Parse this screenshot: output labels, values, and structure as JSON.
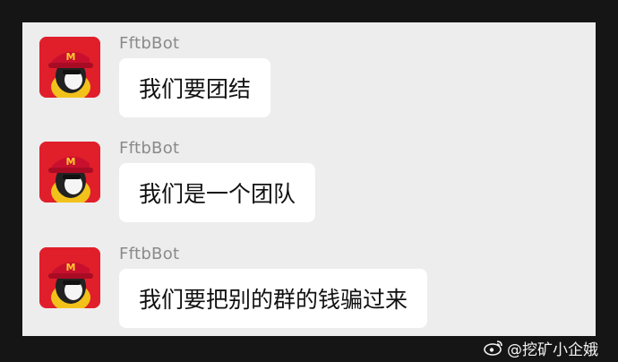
{
  "messages": [
    {
      "sender": "FftbBot",
      "text": "我们要团结"
    },
    {
      "sender": "FftbBot",
      "text": "我们是一个团队"
    },
    {
      "sender": "FftbBot",
      "text": "我们要把别的群的钱骗过来"
    }
  ],
  "watermark": {
    "icon": "weibo-icon",
    "text": "@挖矿小企娥"
  },
  "colors": {
    "background": "#151515",
    "chat_panel": "#ededed",
    "bubble": "#ffffff",
    "avatar_bg": "#e01f2b",
    "cap": "#c8102e",
    "logo": "#ffc72c"
  }
}
